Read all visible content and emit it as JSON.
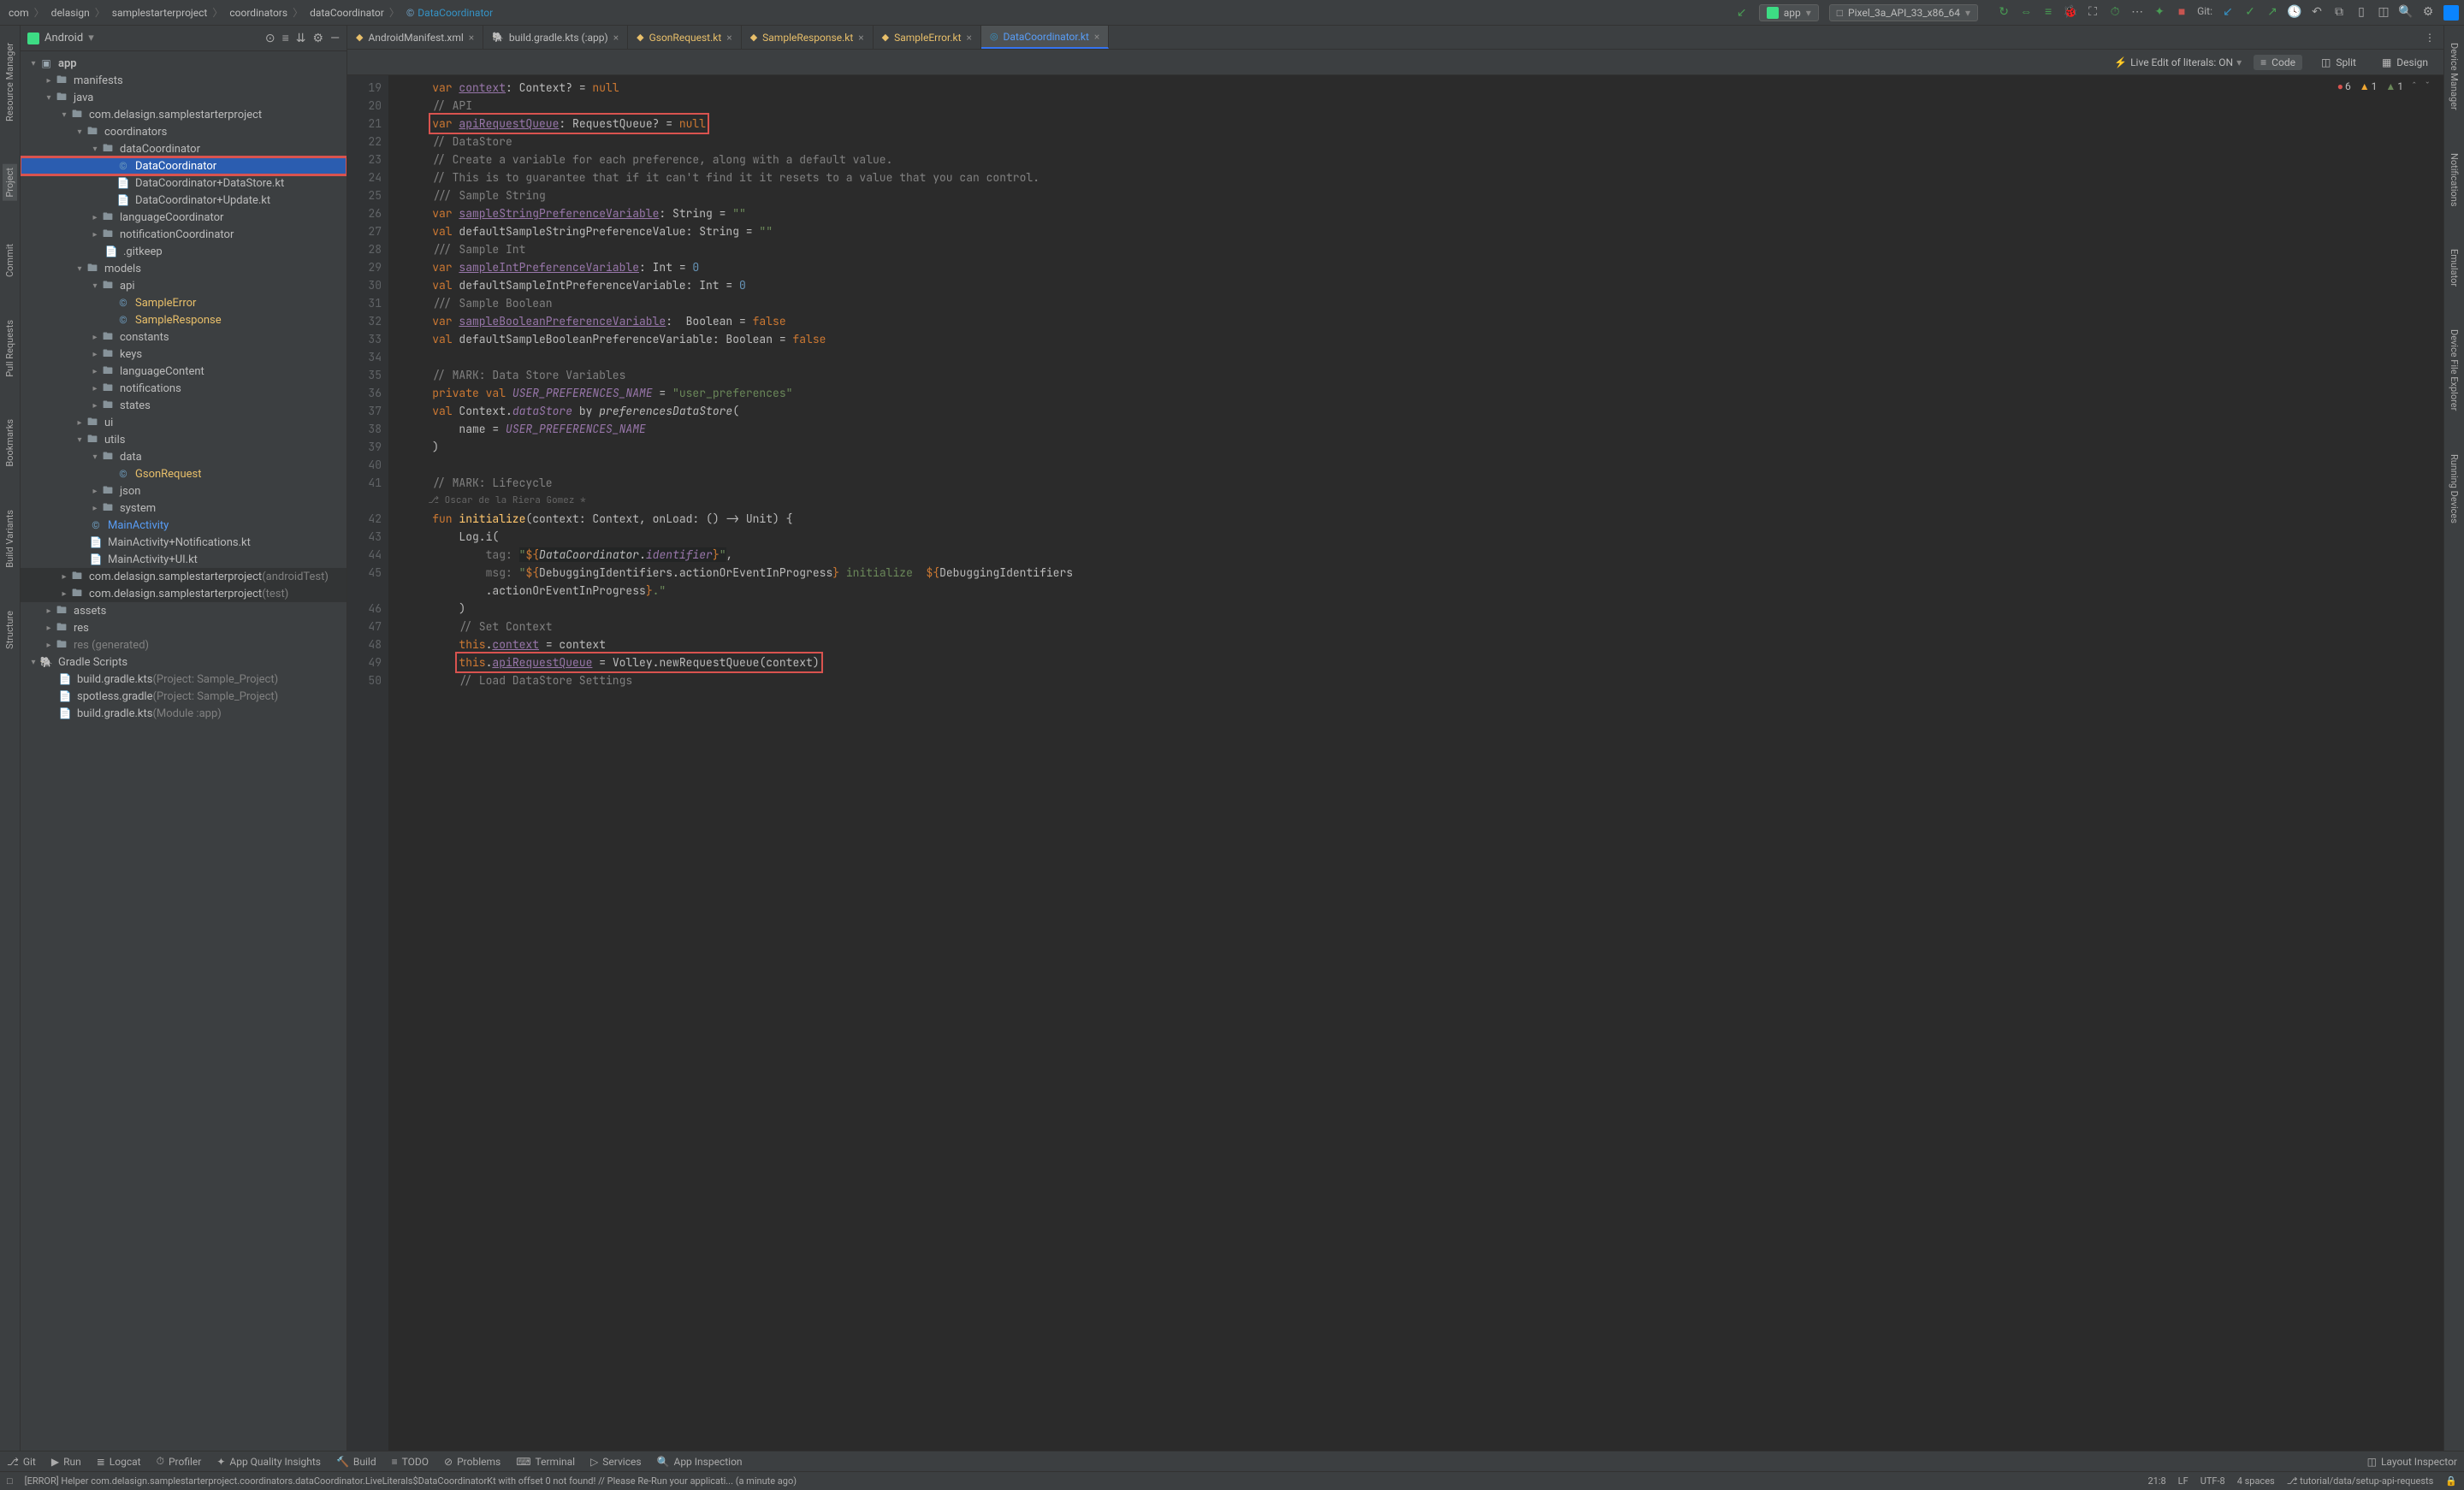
{
  "breadcrumbs": [
    "com",
    "delasign",
    "samplestarterproject",
    "coordinators",
    "dataCoordinator",
    "DataCoordinator"
  ],
  "run_config": "app",
  "device": "Pixel_3a_API_33_x86_64",
  "git_label": "Git:",
  "sidebar_title": "Android",
  "left_tabs": [
    "Resource Manager",
    "Project",
    "Commit",
    "Pull Requests",
    "Bookmarks",
    "Build Variants",
    "Structure"
  ],
  "right_tabs": [
    "Device Manager",
    "Notifications",
    "Emulator",
    "Device File Explorer",
    "Running Devices"
  ],
  "tree": {
    "root": "app",
    "manifests": "manifests",
    "java": "java",
    "pkg": "com.delasign.samplestarterproject",
    "coordinators": "coordinators",
    "dataCoordinator": "dataCoordinator",
    "dc_file": "DataCoordinator",
    "dc_ds": "DataCoordinator+DataStore.kt",
    "dc_up": "DataCoordinator+Update.kt",
    "lang": "languageCoordinator",
    "notif": "notificationCoordinator",
    "gitkeep": ".gitkeep",
    "models": "models",
    "api": "api",
    "sample_error": "SampleError",
    "sample_response": "SampleResponse",
    "constants": "constants",
    "keys": "keys",
    "languageContent": "languageContent",
    "notifications": "notifications",
    "states": "states",
    "ui": "ui",
    "utils": "utils",
    "data": "data",
    "gson": "GsonRequest",
    "json": "json",
    "system": "system",
    "main_activity": "MainActivity",
    "main_notif": "MainActivity+Notifications.kt",
    "main_ui": "MainActivity+UI.kt",
    "pkg_atest": "com.delasign.samplestarterproject",
    "pkg_atest_suffix": " (androidTest)",
    "pkg_test": "com.delasign.samplestarterproject",
    "pkg_test_suffix": " (test)",
    "assets": "assets",
    "res": "res",
    "res_gen": "res (generated)",
    "gradle_scripts": "Gradle Scripts",
    "bg_kts_proj": "build.gradle.kts",
    "bg_kts_proj_suffix": " (Project: Sample_Project)",
    "spotless": "spotless.gradle",
    "spotless_suffix": " (Project: Sample_Project)",
    "bg_kts_mod": "build.gradle.kts",
    "bg_kts_mod_suffix": " (Module :app)"
  },
  "tabs": [
    {
      "label": "AndroidManifest.xml",
      "icon": "xml"
    },
    {
      "label": "build.gradle.kts (:app)",
      "icon": "gradle"
    },
    {
      "label": "GsonRequest.kt",
      "icon": "kt-orange"
    },
    {
      "label": "SampleResponse.kt",
      "icon": "kt-orange"
    },
    {
      "label": "SampleError.kt",
      "icon": "kt-orange"
    },
    {
      "label": "DataCoordinator.kt",
      "icon": "kt-blue",
      "active": true
    }
  ],
  "live_edit": "Live Edit of literals: ON",
  "view_modes": {
    "code": "Code",
    "split": "Split",
    "design": "Design"
  },
  "inspections": {
    "errors": "6",
    "warnings": "1",
    "weak": "1"
  },
  "gutter_start": 19,
  "gutter_end": 50,
  "author": "Oscar de la Riera Gomez *",
  "code_lines": {
    "l19": {
      "pre": "    ",
      "kw": "var ",
      "prop": "context",
      "rest": ": Context? = ",
      "null": "null"
    },
    "l20": {
      "cmt": "    // API"
    },
    "l21": {
      "pre": "    ",
      "kw": "var ",
      "prop": "apiRequestQueue",
      "rest": ": RequestQueue? = ",
      "null": "null",
      "red": true
    },
    "l22": {
      "cmt": "    // DataStore"
    },
    "l23": {
      "cmt": "    // Create a variable for each preference, along with a default value."
    },
    "l24": {
      "cmt": "    // This is to guarantee that if it can't find it it resets to a value that you can control."
    },
    "l25": {
      "cmt": "    /// Sample String"
    },
    "l26": {
      "pre": "    ",
      "kw": "var ",
      "prop": "sampleStringPreferenceVariable",
      "rest": ": String = ",
      "str": "\"\""
    },
    "l27": {
      "pre": "    ",
      "kw": "val ",
      "name": "defaultSampleStringPreferenceValue",
      "rest": ": String = ",
      "str": "\"\""
    },
    "l28": {
      "cmt": "    /// Sample Int"
    },
    "l29": {
      "pre": "    ",
      "kw": "var ",
      "prop": "sampleIntPreferenceVariable",
      "rest": ": Int = ",
      "num": "0"
    },
    "l30": {
      "pre": "    ",
      "kw": "val ",
      "name": "defaultSampleIntPreferenceVariable",
      "rest": ": Int = ",
      "num": "0"
    },
    "l31": {
      "cmt": "    /// Sample Boolean"
    },
    "l32": {
      "pre": "    ",
      "kw": "var ",
      "prop": "sampleBooleanPreferenceVariable",
      "rest": ":  Boolean = ",
      "null": "false"
    },
    "l33": {
      "pre": "    ",
      "kw": "val ",
      "name": "defaultSampleBooleanPreferenceVariable",
      "rest": ": Boolean = ",
      "null": "false"
    },
    "l34": {
      "blank": " "
    },
    "l35": {
      "cmt": "    // MARK: Data Store Variables"
    },
    "l36": {
      "pre": "    ",
      "kw": "private val ",
      "const": "USER_PREFERENCES_NAME",
      "rest": " = ",
      "str": "\"user_preferences\""
    },
    "l37": {
      "pre": "    ",
      "kw": "val ",
      "name": "Context.",
      "it": "dataStore",
      "by": " by ",
      "it2": "preferencesDataStore",
      "paren": "("
    },
    "l38": {
      "pre": "        ",
      "name": "name = ",
      "const": "USER_PREFERENCES_NAME"
    },
    "l39": {
      "pre": "    ",
      "paren": ")"
    },
    "l40": {
      "blank": " "
    },
    "l41": {
      "cmt": "    // MARK: Lifecycle"
    },
    "author_line": "    ⎇ Oscar de la Riera Gomez *",
    "l42": {
      "pre": "    ",
      "kw": "fun ",
      "fn": "initialize",
      "sig": "(context: Context, onLoad: () -> Unit) {"
    },
    "l43": {
      "pre": "        ",
      "name": "Log.i("
    },
    "l44": {
      "pre": "            ",
      "hint": "tag: ",
      "str_open": "\"",
      "tpl": "${",
      "tpl_body": "DataCoordinator.",
      "tpl_id": "identifier",
      "tpl_close": "}",
      "str_close": "\"",
      "comma": ","
    },
    "l45": {
      "pre": "            ",
      "hint": "msg: ",
      "str_open": "\"",
      "tpl": "${",
      "tpl_body": "DebuggingIdentifiers.actionOrEventInProgress",
      "tpl_close": "}",
      "mid": " initialize  ",
      "tpl2": "${",
      "tpl2_body": "DebuggingIdentifiers"
    },
    "l45b": {
      "pre": "            ",
      "tpl_cont": ".actionOrEventInProgress",
      "tpl_close": "}",
      "str_tail": ".\""
    },
    "l46": {
      "pre": "        ",
      ")": " )"
    },
    "l47": {
      "cmt": "        // Set Context"
    },
    "l48": {
      "pre": "        ",
      "kw": "this",
      "dot": ".",
      "prop": "context",
      "rest": " = context"
    },
    "l49": {
      "pre": "        ",
      "kw": "this",
      "dot": ".",
      "prop": "apiRequestQueue",
      "rest": " = Volley.newRequestQueue(context)",
      "red": true
    },
    "l50": {
      "cmt": "        // Load DataStore Settings"
    }
  },
  "bottom_items": [
    "Git",
    "Run",
    "Logcat",
    "Profiler",
    "App Quality Insights",
    "Build",
    "TODO",
    "Problems",
    "Terminal",
    "Services",
    "App Inspection"
  ],
  "bottom_right": "Layout Inspector",
  "status_msg": "[ERROR] Helper com.delasign.samplestarterproject.coordinators.dataCoordinator.LiveLiterals$DataCoordinatorKt with offset 0 not found! // Please Re-Run your applicati... (a minute ago)",
  "status_right": {
    "pos": "21:8",
    "le": "LF",
    "enc": "UTF-8",
    "indent": "4 spaces",
    "branch": "tutorial/data/setup-api-requests"
  }
}
